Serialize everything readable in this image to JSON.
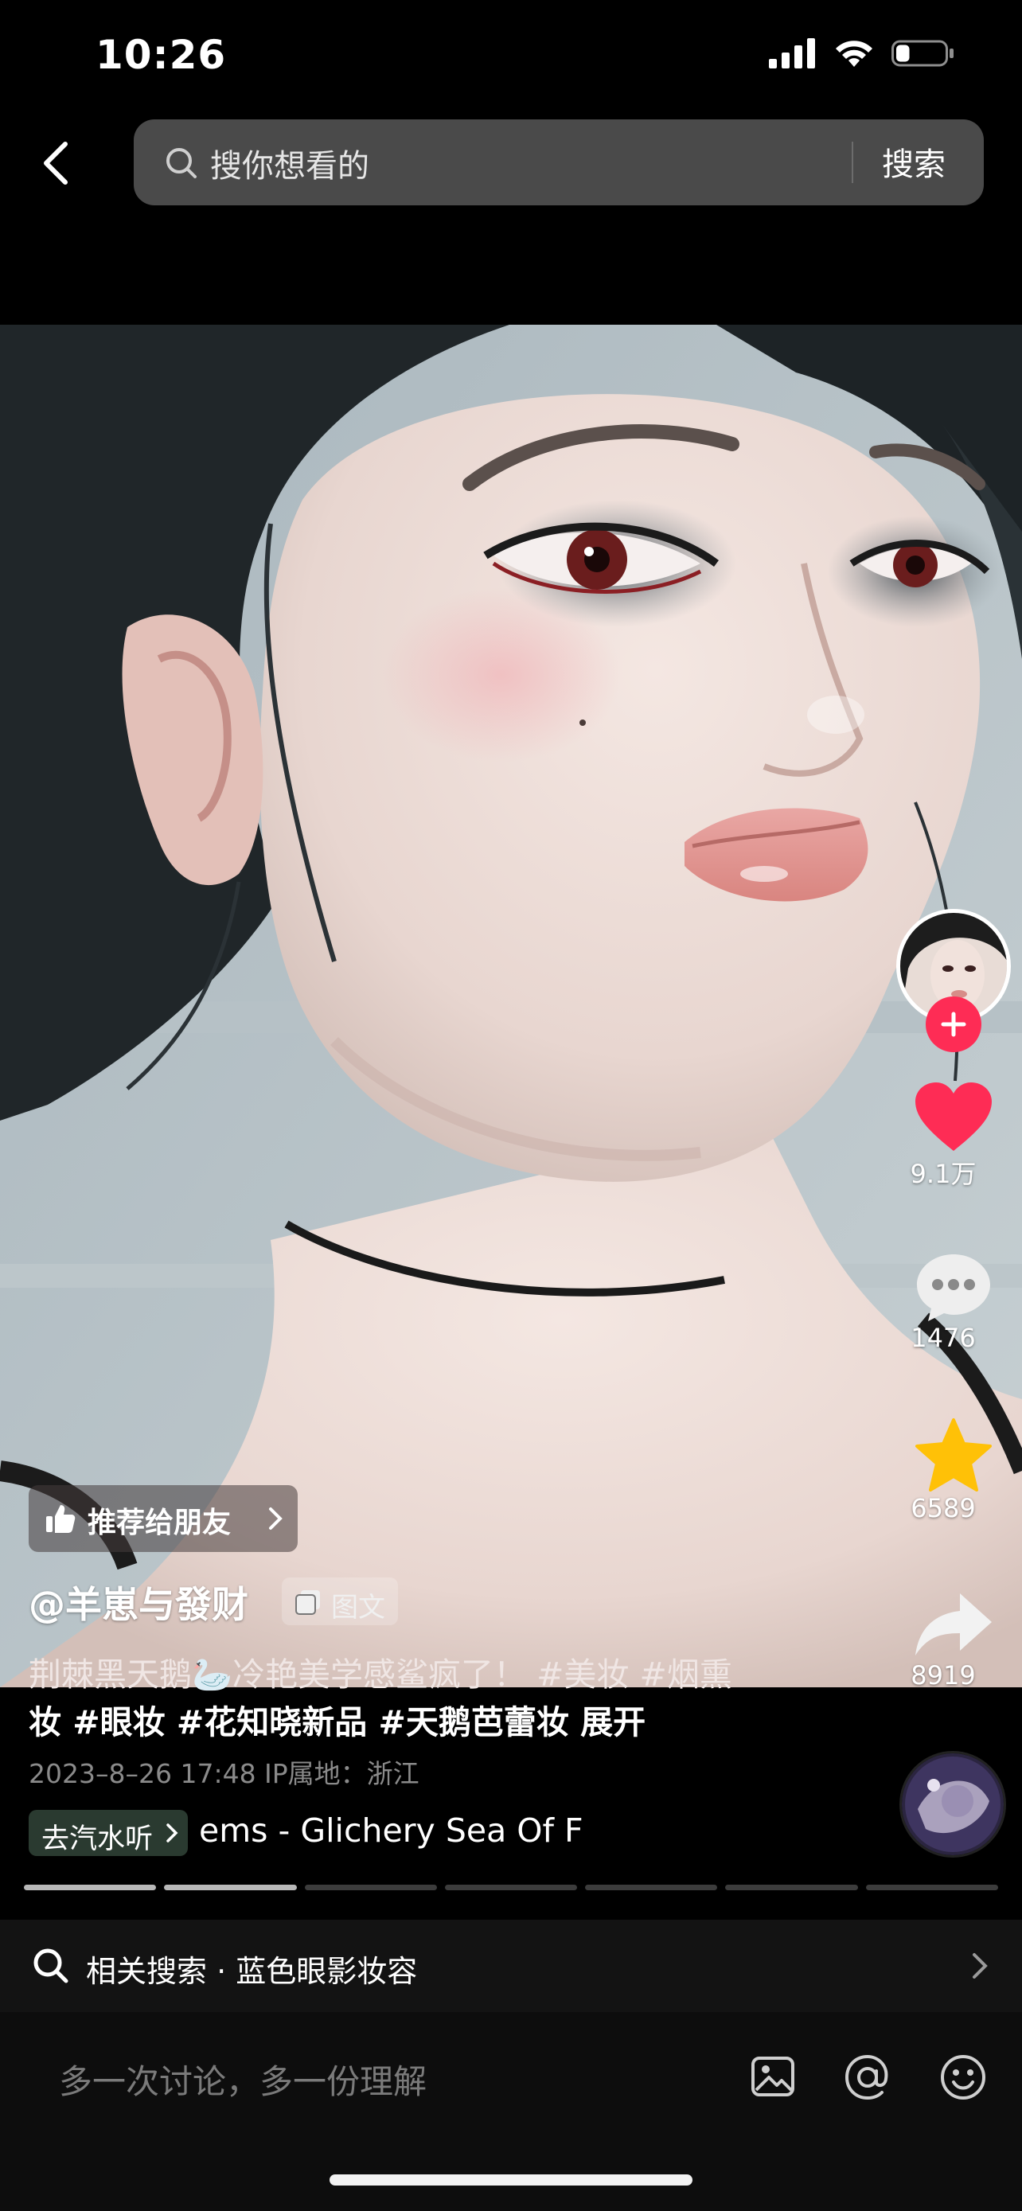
{
  "status_bar": {
    "time": "10:26",
    "battery_level": 0.28
  },
  "header": {
    "search_placeholder": "搜你想看的",
    "search_button": "搜索"
  },
  "rail": {
    "likes": "9.1万",
    "comments": "1476",
    "favorites": "6589",
    "shares": "8919"
  },
  "post": {
    "recommend_label": "推荐给朋友",
    "author": "@羊崽与發财",
    "type_badge": "图文",
    "caption_line1": "荆棘黑天鹅🦢冷艳美学感鲨疯了！ #美妆 #烟熏",
    "caption_line2": "妆 #眼妆 #花知晓新品 #天鹅芭蕾妆  展开",
    "meta": "2023–8–26 17:48   IP属地：浙江",
    "music_chip": "去汽水听",
    "music_title": "ems - Glichery    Sea Of F"
  },
  "progress": {
    "segments": 7,
    "active": 2
  },
  "related_search": {
    "label": "相关搜索 · 蓝色眼影妆容"
  },
  "comment_bar": {
    "placeholder": "多一次讨论，多一份理解"
  },
  "colors": {
    "like_red": "#fe2c55",
    "favorite_yellow": "#ffc107",
    "follow_pink": "#fe2c55"
  }
}
